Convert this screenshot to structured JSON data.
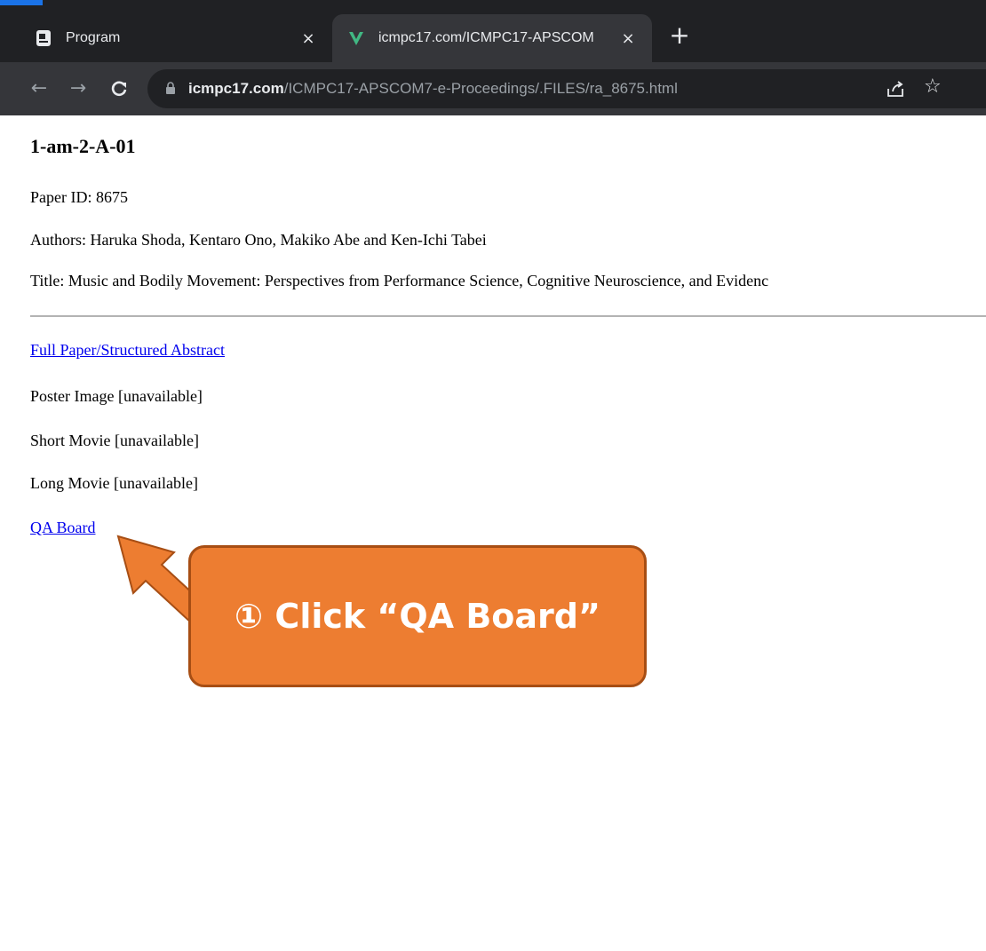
{
  "browser": {
    "tabs": [
      {
        "title": "Program",
        "icon": "document-icon",
        "active": false
      },
      {
        "title": "icmpc17.com/ICMPC17-APSCOM",
        "icon": "site-v-icon",
        "active": true
      }
    ],
    "close_glyph": "×",
    "new_tab_glyph": "+",
    "nav": {
      "back": "←",
      "forward": "→",
      "reload": "C"
    },
    "address": {
      "host": "icmpc17.com",
      "path": "/ICMPC17-APSCOM7-e-Proceedings/.FILES/ra_8675.html"
    },
    "star_glyph": "☆",
    "colors": {
      "tabstrip": "#202124",
      "toolbar": "#35363a",
      "accent": "#1a73e8"
    }
  },
  "page": {
    "heading": "1-am-2-A-01",
    "paper_id": "Paper ID: 8675",
    "authors": "Authors: Haruka Shoda, Kentaro Ono, Makiko Abe and Ken-Ichi Tabei",
    "title": "Title: Music and Bodily Movement: Perspectives from Performance Science, Cognitive Neuroscience, and Evidenc",
    "links": {
      "full_paper": "Full Paper/Structured Abstract",
      "qa_board": "QA Board"
    },
    "poster": "Poster Image [unavailable]",
    "short_movie": "Short Movie [unavailable]",
    "long_movie": "Long Movie [unavailable]",
    "link_color": "#0000ee"
  },
  "annotation": {
    "text": "① Click “QA Board”",
    "fill_color": "#ed7d31",
    "border_color": "#a74e14"
  }
}
